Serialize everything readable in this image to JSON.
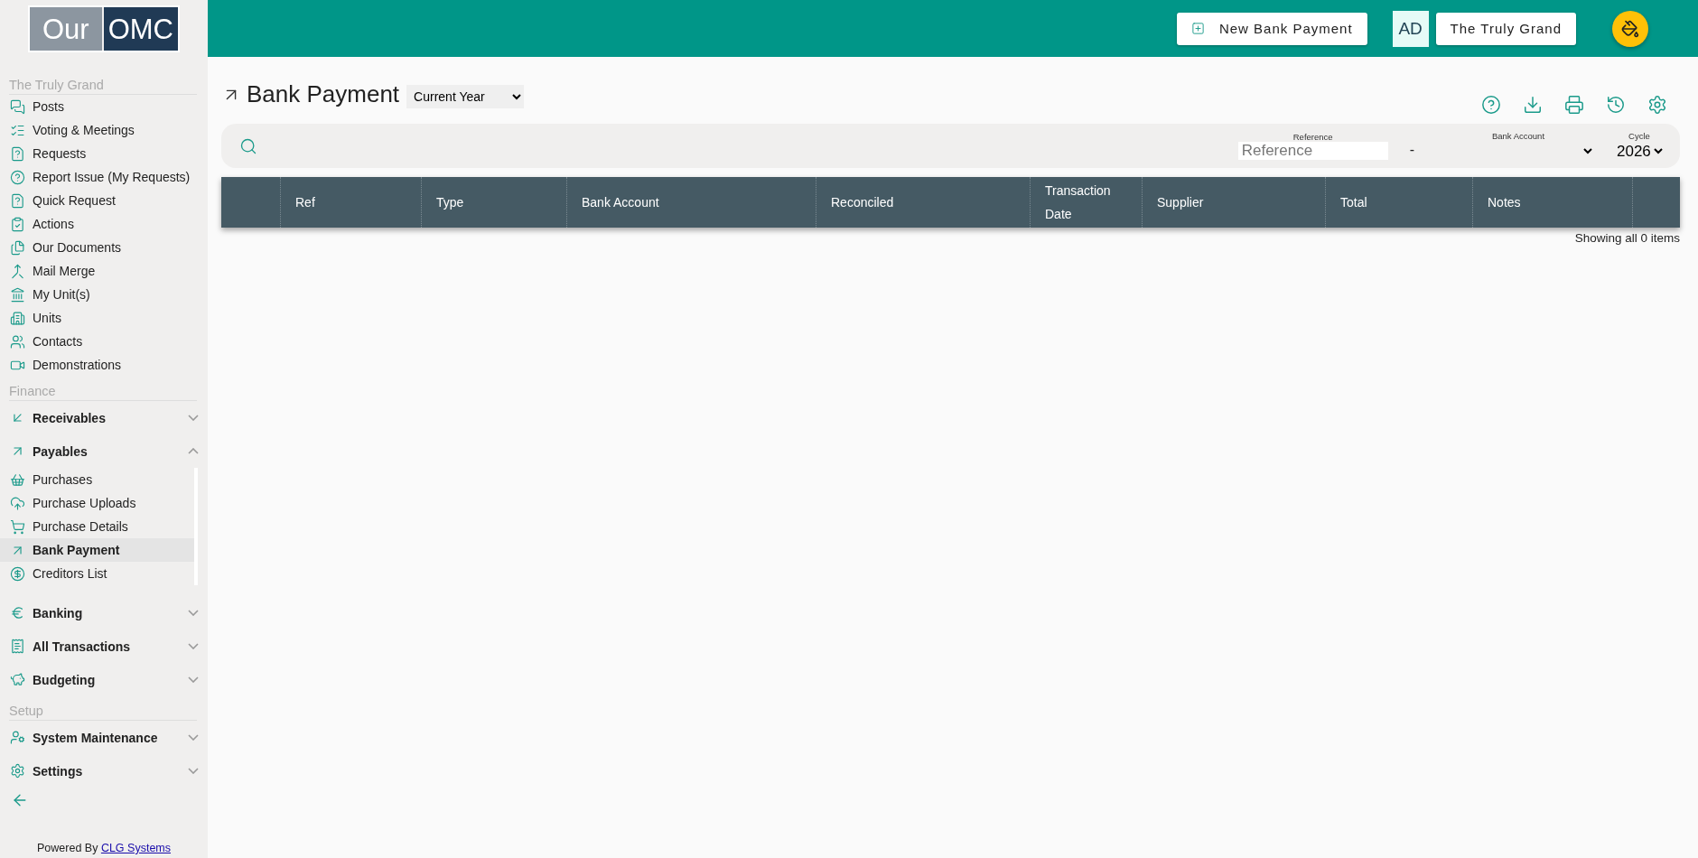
{
  "sidebar": {
    "logo": {
      "left": "Our",
      "right": "OMC"
    },
    "sections": [
      {
        "title": "The Truly Grand",
        "items": [
          {
            "kind": "link",
            "label": "Posts",
            "selected": false
          },
          {
            "kind": "link",
            "label": "Voting & Meetings",
            "selected": false
          },
          {
            "kind": "link",
            "label": "Requests",
            "selected": false
          },
          {
            "kind": "link",
            "label": "Report Issue (My Requests)",
            "selected": false
          },
          {
            "kind": "link",
            "label": "Quick Request",
            "selected": false
          },
          {
            "kind": "link",
            "label": "Actions",
            "selected": false
          },
          {
            "kind": "link",
            "label": "Our Documents",
            "selected": false
          },
          {
            "kind": "link",
            "label": "Mail Merge",
            "selected": false
          },
          {
            "kind": "link",
            "label": "My Unit(s)",
            "selected": false
          },
          {
            "kind": "link",
            "label": "Units",
            "selected": false
          },
          {
            "kind": "link",
            "label": "Contacts",
            "selected": false
          },
          {
            "kind": "link",
            "label": "Demonstrations",
            "selected": false
          }
        ]
      },
      {
        "title": "Finance",
        "items": [
          {
            "kind": "group",
            "label": "Receivables",
            "expanded": false
          },
          {
            "kind": "group",
            "label": "Payables",
            "expanded": true,
            "children": [
              {
                "label": "Purchases",
                "selected": false
              },
              {
                "label": "Purchase Uploads",
                "selected": false
              },
              {
                "label": "Purchase Details",
                "selected": false
              },
              {
                "label": "Bank Payment",
                "selected": true
              },
              {
                "label": "Creditors List",
                "selected": false
              }
            ]
          },
          {
            "kind": "group",
            "label": "Banking",
            "expanded": false
          },
          {
            "kind": "group",
            "label": "All Transactions",
            "expanded": false
          },
          {
            "kind": "group",
            "label": "Budgeting",
            "expanded": false
          }
        ]
      },
      {
        "title": "Setup",
        "items": [
          {
            "kind": "group",
            "label": "System Maintenance",
            "expanded": false
          },
          {
            "kind": "group",
            "label": "Settings",
            "expanded": false
          }
        ]
      }
    ],
    "footer": {
      "text": "Powered By",
      "link": "CLG Systems"
    }
  },
  "header": {
    "new_button": "New Bank Payment",
    "avatar": "AD",
    "site_button": "The Truly Grand"
  },
  "page": {
    "title": "Bank Payment",
    "period": "Current Year"
  },
  "filters": {
    "reference": {
      "label": "Reference",
      "placeholder": "Reference"
    },
    "separator": "-",
    "bank_account": {
      "label": "Bank Account"
    },
    "cycle": {
      "label": "Cycle",
      "value": "2026"
    }
  },
  "table": {
    "columns": [
      "Ref",
      "Type",
      "Bank Account",
      "Reconciled",
      "Transaction Date",
      "Supplier",
      "Total",
      "Notes"
    ]
  },
  "status": "Showing all 0 items"
}
